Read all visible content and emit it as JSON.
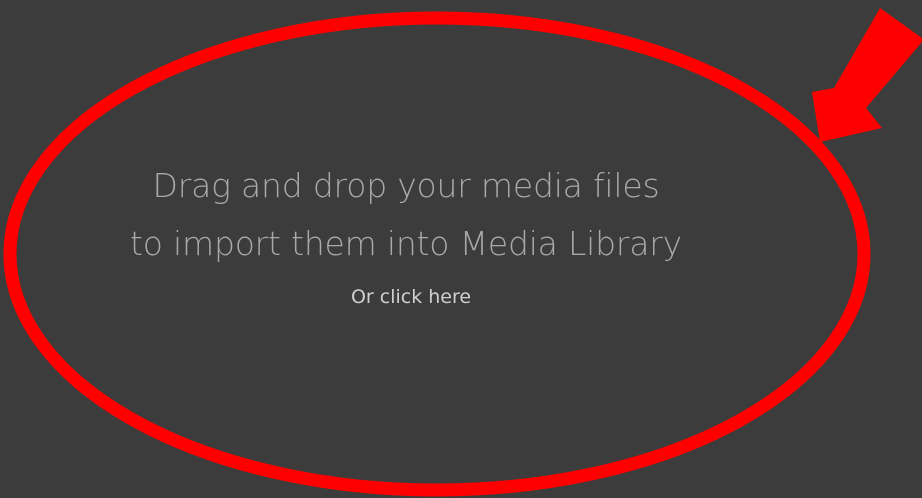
{
  "drop_zone": {
    "line1": "Drag and drop your media files",
    "line2": "to import them into Media Library",
    "click_link": "Or click here"
  },
  "colors": {
    "background": "#3c3c3c",
    "primary_text": "#a9a9a9",
    "link_text": "#cfcfcf",
    "annotation": "#ff0000"
  },
  "annotation": {
    "shape": "ellipse-outline",
    "pointer": "arrow-icon"
  }
}
